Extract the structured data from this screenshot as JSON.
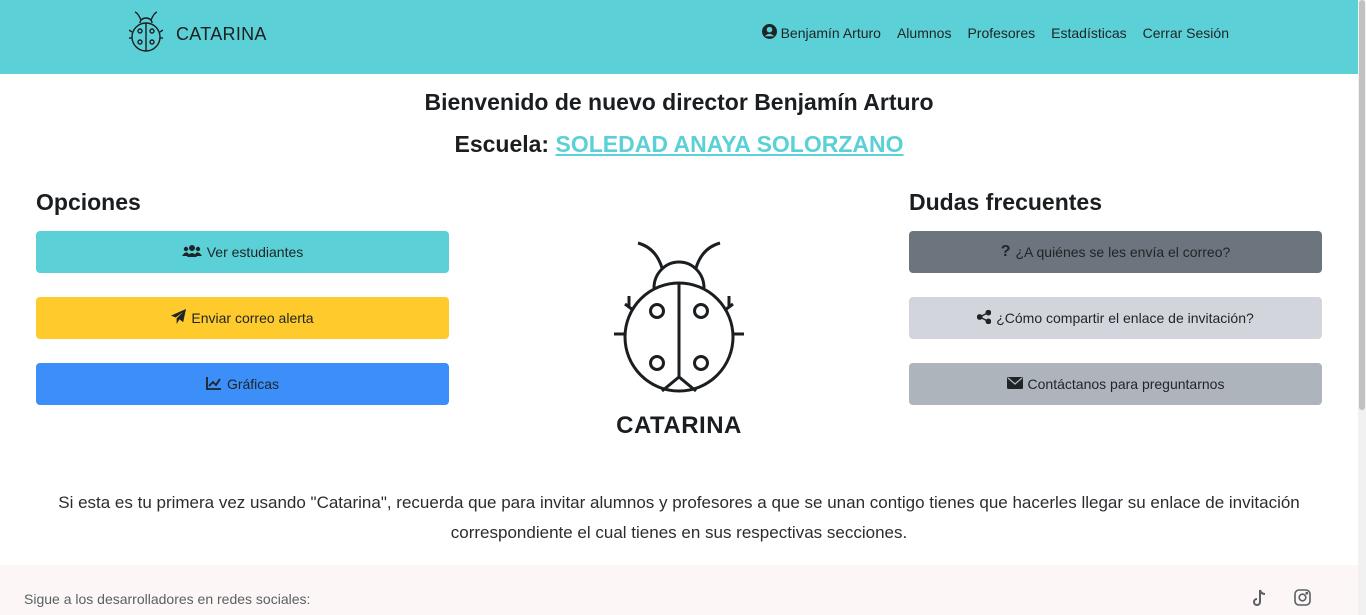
{
  "brand": {
    "name": "CATARINA",
    "icon": "ladybug-icon"
  },
  "nav": {
    "user": "Benjamín Arturo",
    "alumnos": "Alumnos",
    "profesores": "Profesores",
    "estadisticas": "Estadísticas",
    "logout": "Cerrar Sesión"
  },
  "welcome": {
    "title": "Bienvenido de nuevo director Benjamín Arturo",
    "school_label": "Escuela:",
    "school_name": "SOLEDAD ANAYA SOLORZANO"
  },
  "options": {
    "title": "Opciones",
    "items": [
      {
        "label": "Ver estudiantes",
        "icon": "users-icon",
        "color": "#5bd0d6"
      },
      {
        "label": "Enviar correo alerta",
        "icon": "paper-plane-icon",
        "color": "#ffca2c"
      },
      {
        "label": "Gráficas",
        "icon": "chart-line-icon",
        "color": "#3c8ff8"
      }
    ]
  },
  "logo": {
    "text": "CATARINA"
  },
  "faq": {
    "title": "Dudas frecuentes",
    "items": [
      {
        "label": "¿A quiénes se les envía el correo?",
        "icon": "question-icon",
        "color": "#6c757d"
      },
      {
        "label": "¿Cómo compartir el enlace de invitación?",
        "icon": "share-icon",
        "color": "#d2d6dc"
      },
      {
        "label": "Contáctanos para preguntarnos",
        "icon": "envelope-icon",
        "color": "#aeb4bb"
      }
    ]
  },
  "info": {
    "text": "Si esta es tu primera vez usando \"Catarina\", recuerda que para invitar alumnos y profesores a que se unan contigo tienes que hacerles llegar su enlace de invitación correspondiente el cual tienes en sus respectivas secciones."
  },
  "footer": {
    "text": "Sigue a los desarrolladores en redes sociales:",
    "social": [
      "tiktok-icon",
      "instagram-icon"
    ]
  }
}
